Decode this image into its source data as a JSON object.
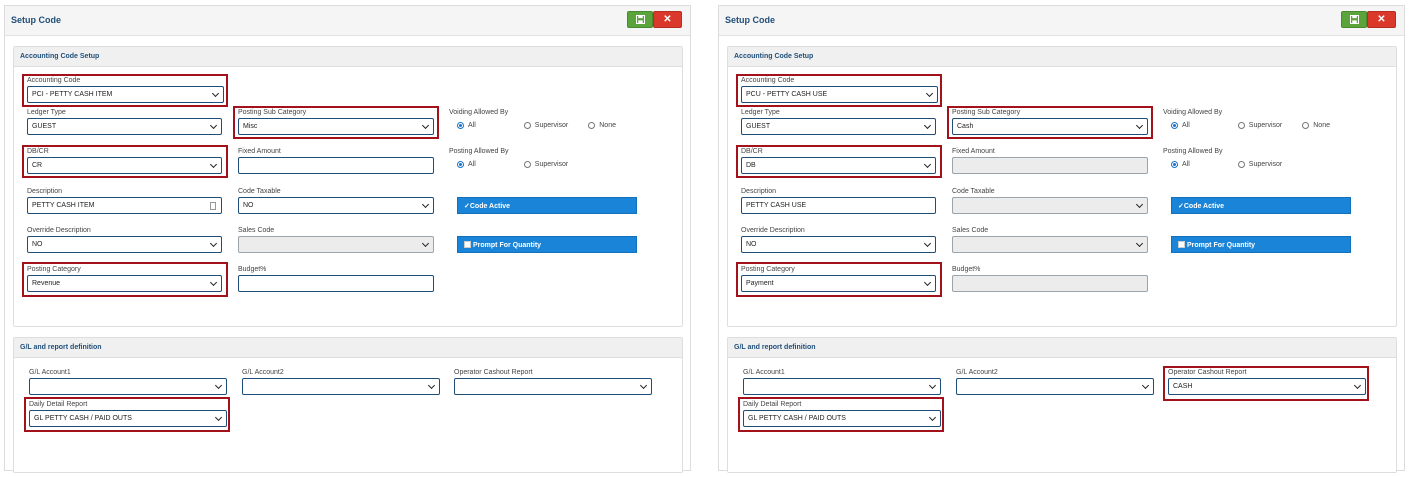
{
  "colors": {
    "title": "#1f4e79",
    "highlight": "#a3121a",
    "save": "#5ba33b",
    "close": "#d9382b",
    "button": "#1a84d8"
  },
  "icons": {
    "save": "save-icon",
    "close": "close-icon"
  },
  "left": {
    "title": "Setup Code",
    "close_label": "✕",
    "accounting_section": "Accounting Code Setup",
    "accounting_code": {
      "label": "Accounting Code",
      "value": "PCI - PETTY CASH ITEM"
    },
    "ledger_type": {
      "label": "Ledger Type",
      "value": "GUEST"
    },
    "posting_sub_category": {
      "label": "Posting Sub Category",
      "value": "Misc"
    },
    "voiding": {
      "label": "Voiding Allowed By",
      "opt1": "All",
      "opt2": "Supervisor",
      "opt3": "None"
    },
    "dbcr": {
      "label": "DB/CR",
      "value": "CR"
    },
    "fixed_amount": {
      "label": "Fixed Amount",
      "value": ""
    },
    "posting_allowed": {
      "label": "Posting Allowed By",
      "opt1": "All",
      "opt2": "Supervisor"
    },
    "description": {
      "label": "Description",
      "value": "PETTY CASH ITEM"
    },
    "code_taxable": {
      "label": "Code Taxable",
      "value": "NO"
    },
    "code_active": "✓Code Active",
    "override_description": {
      "label": "Override Description",
      "value": "NO"
    },
    "sales_code": {
      "label": "Sales Code",
      "value": ""
    },
    "prompt_quantity": "Prompt For Quantity",
    "posting_category": {
      "label": "Posting Category",
      "value": "Revenue"
    },
    "budget": {
      "label": "Budget%",
      "value": ""
    },
    "gl_section": "G/L and report definition",
    "gl1": {
      "label": "G/L Account1",
      "value": ""
    },
    "gl2": {
      "label": "G/L Account2",
      "value": ""
    },
    "operator_cashout": {
      "label": "Operator Cashout Report",
      "value": ""
    },
    "daily_detail": {
      "label": "Daily Detail Report",
      "value": "GL PETTY CASH / PAID OUTS"
    }
  },
  "right": {
    "title": "Setup Code",
    "close_label": "✕",
    "accounting_section": "Accounting Code Setup",
    "accounting_code": {
      "label": "Accounting Code",
      "value": "PCU - PETTY CASH USE"
    },
    "ledger_type": {
      "label": "Ledger Type",
      "value": "GUEST"
    },
    "posting_sub_category": {
      "label": "Posting Sub Category",
      "value": "Cash"
    },
    "voiding": {
      "label": "Voiding Allowed By",
      "opt1": "All",
      "opt2": "Supervisor",
      "opt3": "None"
    },
    "dbcr": {
      "label": "DB/CR",
      "value": "DB"
    },
    "fixed_amount": {
      "label": "Fixed Amount",
      "value": ""
    },
    "posting_allowed": {
      "label": "Posting Allowed By",
      "opt1": "All",
      "opt2": "Supervisor"
    },
    "description": {
      "label": "Description",
      "value": "PETTY CASH USE"
    },
    "code_taxable": {
      "label": "Code Taxable",
      "value": ""
    },
    "code_active": "✓Code Active",
    "override_description": {
      "label": "Override Description",
      "value": "NO"
    },
    "sales_code": {
      "label": "Sales Code",
      "value": ""
    },
    "prompt_quantity": "Prompt For Quantity",
    "posting_category": {
      "label": "Posting Category",
      "value": "Payment"
    },
    "budget": {
      "label": "Budget%",
      "value": ""
    },
    "gl_section": "G/L and report definition",
    "gl1": {
      "label": "G/L Account1",
      "value": ""
    },
    "gl2": {
      "label": "G/L Account2",
      "value": ""
    },
    "operator_cashout": {
      "label": "Operator Cashout Report",
      "value": "CASH"
    },
    "daily_detail": {
      "label": "Daily Detail Report",
      "value": "GL PETTY CASH / PAID OUTS"
    }
  }
}
